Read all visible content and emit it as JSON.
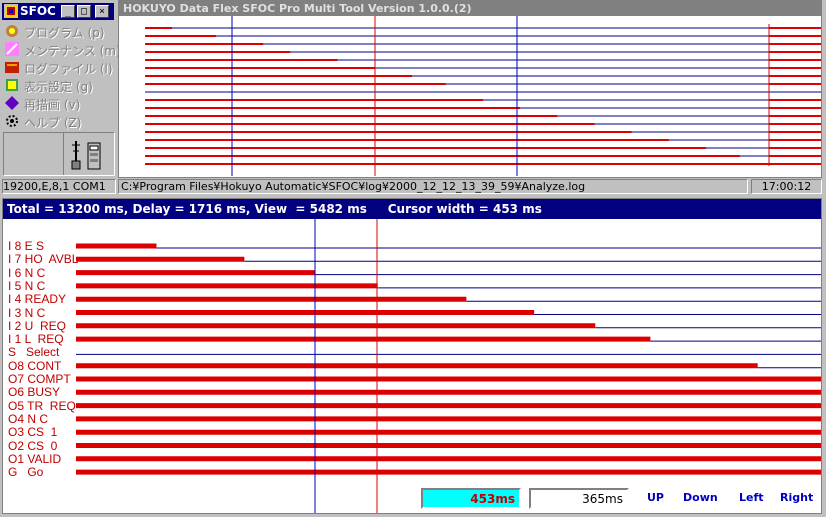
{
  "app": {
    "window_title": "SFOC",
    "main_title": "HOKUYO Data Flex SFOC Pro Multi Tool Version 1.0.0.(2)"
  },
  "window_buttons": [
    "_",
    "□",
    "×"
  ],
  "menu": [
    {
      "label": "プログラム (p)",
      "icon": "program-icon"
    },
    {
      "label": "メンテナンス (m)",
      "icon": "maintenance-icon"
    },
    {
      "label": "ログファイル (l)",
      "icon": "logfile-icon"
    },
    {
      "label": "表示設定 (g)",
      "icon": "display-settings-icon"
    },
    {
      "label": "再描画 (v)",
      "icon": "redraw-icon"
    },
    {
      "label": "ヘルプ (Z)",
      "icon": "help-icon"
    }
  ],
  "status": {
    "comm": "19200,E,8,1 COM1",
    "path": "C:¥Program Files¥Hokuyo Automatic¥SFOC¥log¥2000_12_12_13_39_59¥Analyze.log",
    "time": "17:00:12"
  },
  "detail": {
    "info": "Total = 13200 ms, Delay = 1716 ms, View  = 5482 ms     Cursor width = 453 ms"
  },
  "signals": [
    {
      "label": "I 8 E S",
      "low": false,
      "change": 0.04
    },
    {
      "label": "I 7 HO  AVBL",
      "low": false,
      "change": 0.105
    },
    {
      "label": "I 6 N C",
      "low": false,
      "change": 0.175
    },
    {
      "label": "I 5 N C",
      "low": false,
      "change": 0.215
    },
    {
      "label": "I 4 READY",
      "low": false,
      "change": 0.285
    },
    {
      "label": "I 3 N C",
      "low": false,
      "change": 0.34
    },
    {
      "label": "I 2 U  REQ",
      "low": false,
      "change": 0.395
    },
    {
      "label": "I 1 L  REQ",
      "low": false,
      "change": 0.445
    },
    {
      "label": "S   Select",
      "low": true,
      "change": 1.0
    },
    {
      "label": "O8 CONT",
      "low": false,
      "change": 0.5
    },
    {
      "label": "O7 COMPT",
      "low": false,
      "change": 0.555
    },
    {
      "label": "O6 BUSY",
      "low": false,
      "change": 0.61
    },
    {
      "label": "O5 TR  REQ",
      "low": false,
      "change": 0.665
    },
    {
      "label": "O4 N C",
      "low": false,
      "change": 0.72
    },
    {
      "label": "O3 CS  1",
      "low": false,
      "change": 0.775
    },
    {
      "label": "O2 CS  0",
      "low": false,
      "change": 0.83
    },
    {
      "label": "O1 VALID",
      "low": false,
      "change": 0.88
    },
    {
      "label": "G   Go",
      "low": false,
      "change": 0.93
    }
  ],
  "detail_traces": [
    {
      "end": 0.108
    },
    {
      "end": 0.226
    },
    {
      "end": 0.321
    },
    {
      "end": 0.405
    },
    {
      "end": 0.524
    },
    {
      "end": 0.615
    },
    {
      "end": 0.697
    },
    {
      "end": 0.771
    },
    {
      "end": 0.0
    },
    {
      "end": 0.915
    },
    {
      "end": 1.0
    },
    {
      "end": 1.0
    },
    {
      "end": 1.0
    },
    {
      "end": 1.0
    },
    {
      "end": 1.0
    },
    {
      "end": 1.0
    },
    {
      "end": 1.0
    },
    {
      "end": 1.0
    }
  ],
  "controls": {
    "cursor_width_display": "453ms",
    "step_input": "365ms",
    "up": "UP",
    "down": "Down",
    "left": "Left",
    "right": "Right"
  },
  "colors": {
    "signal": "#dc0000",
    "grid": "#000080",
    "cursor_blue": "#0000c0",
    "cursor_red": "#e00000",
    "highlight": "#00ffff"
  }
}
